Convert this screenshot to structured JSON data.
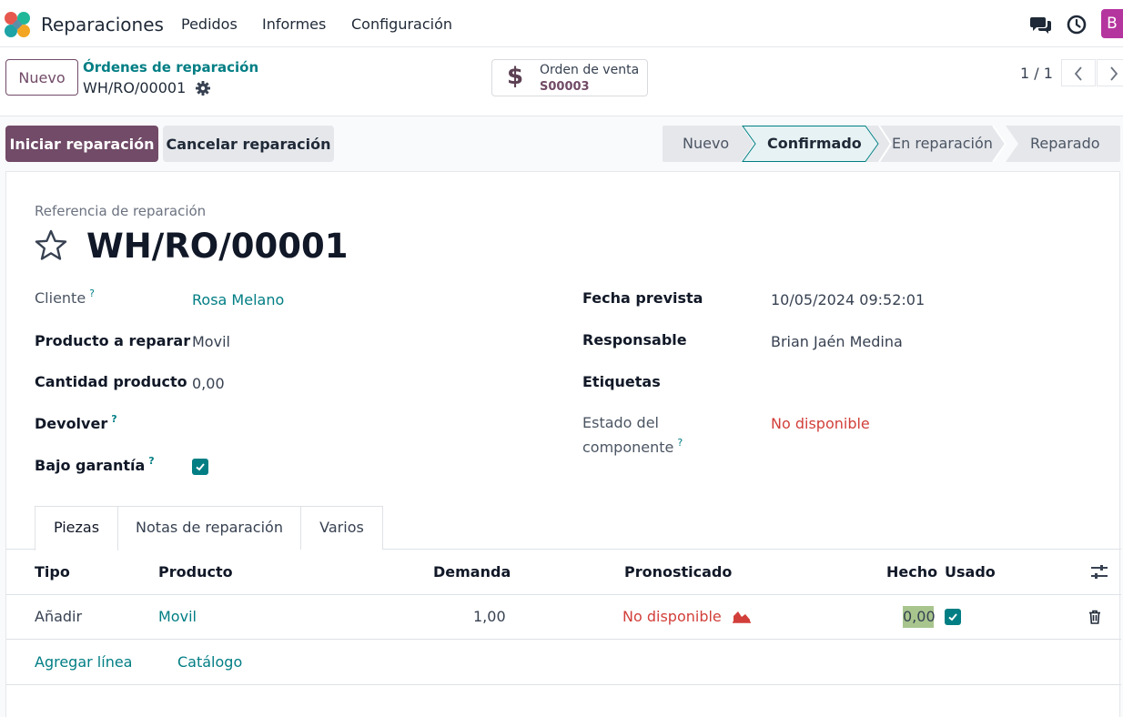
{
  "navbar": {
    "app_name": "Reparaciones",
    "menu": [
      "Pedidos",
      "Informes",
      "Configuración"
    ],
    "avatar_letter": "B"
  },
  "control_panel": {
    "new_button": "Nuevo",
    "breadcrumb_parent": "Órdenes de reparación",
    "breadcrumb_current": "WH/RO/00001",
    "smart_button": {
      "label": "Orden de venta",
      "value": "S00003",
      "icon": "dollar-icon"
    },
    "pager": "1 / 1"
  },
  "actions": {
    "start_repair": "Iniciar reparación",
    "cancel_repair": "Cancelar reparación"
  },
  "statusbar": {
    "stages": [
      "Nuevo",
      "Confirmado",
      "En reparación",
      "Reparado"
    ],
    "current": "Confirmado"
  },
  "form": {
    "ref_label": "Referencia de reparación",
    "title": "WH/RO/00001",
    "left": {
      "customer_label": "Cliente",
      "customer_value": "Rosa Melano",
      "product_label": "Producto a reparar",
      "product_value": "Movil",
      "qty_label": "Cantidad producto",
      "qty_value": "0,00",
      "return_label": "Devolver",
      "warranty_label": "Bajo garantía",
      "warranty_checked": true
    },
    "right": {
      "date_label": "Fecha prevista",
      "date_value": "10/05/2024 09:52:01",
      "responsible_label": "Responsable",
      "responsible_value": "Brian Jaén Medina",
      "tags_label": "Etiquetas",
      "component_status_label_1": "Estado del",
      "component_status_label_2": "componente",
      "component_status_value": "No disponible"
    },
    "help_mark": "?"
  },
  "tabs": [
    "Piezas",
    "Notas de reparación",
    "Varios"
  ],
  "parts_table": {
    "columns": [
      "Tipo",
      "Producto",
      "Demanda",
      "Pronosticado",
      "Hecho",
      "Usado"
    ],
    "rows": [
      {
        "type": "Añadir",
        "product": "Movil",
        "demand": "1,00",
        "forecast": "No disponible",
        "done": "0,00",
        "used": true
      }
    ],
    "add_line": "Agregar línea",
    "catalog": "Catálogo"
  },
  "colors": {
    "brand": "#714b67",
    "link": "#017e84",
    "danger": "#d23f3a"
  }
}
